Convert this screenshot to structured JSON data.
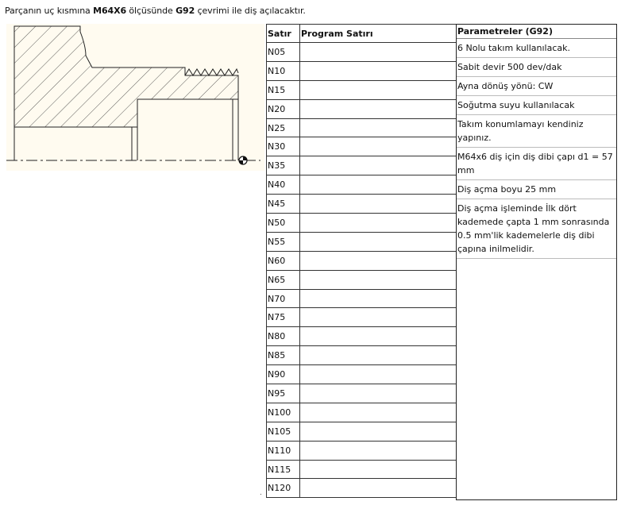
{
  "title": {
    "part1": "Parçanın uç kısmına ",
    "bold1": "M64X6",
    "part2": " ölçüsünde ",
    "bold2": "G92",
    "part3": " çevrimi ile diş açılacaktır."
  },
  "table": {
    "headers": [
      "Satır",
      "Program Satırı"
    ],
    "rows": [
      "N05",
      "N10",
      "N15",
      "N20",
      "N25",
      "N30",
      "N35",
      "N40",
      "N45",
      "N50",
      "N55",
      "N60",
      "N65",
      "N70",
      "N75",
      "N80",
      "N85",
      "N90",
      "N95",
      "N100",
      "N105",
      "N110",
      "N115",
      "N120"
    ]
  },
  "params": {
    "header": "Parametreler (G92)",
    "items": [
      "6 Nolu takım kullanılacak.",
      "Sabit devir 500 dev/dak",
      "Ayna dönüş yönü: CW",
      "Soğutma suyu kullanılacak",
      "Takım konumlamayı kendiniz yapınız.",
      "M64x6 diş için diş dibi çapı d1 = 57 mm",
      "Diş açma boyu 25 mm",
      "Diş açma işleminde İlk dört kademede çapta 1 mm sonrasında 0.5 mm'lik kademelerle diş dibi çapına inilmelidir."
    ]
  },
  "colors": {
    "drawing_bg": "#fffbf0",
    "line": "#222222"
  }
}
